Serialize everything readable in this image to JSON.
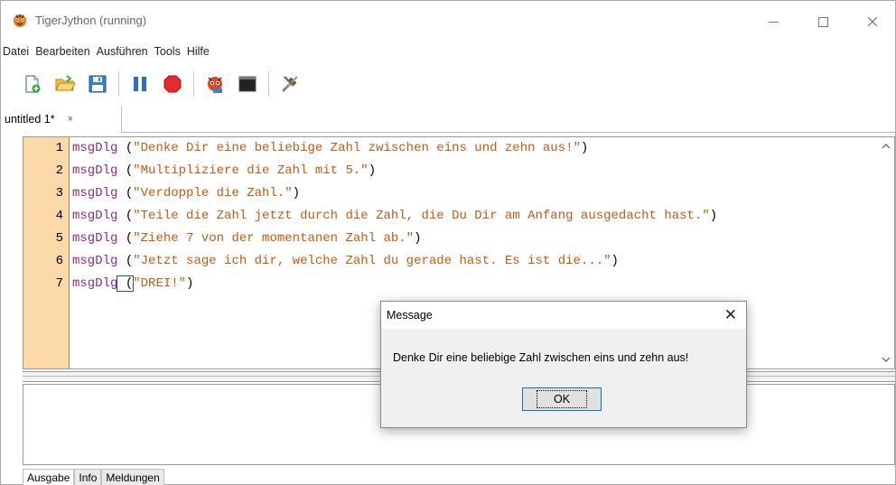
{
  "window": {
    "title": "TigerJython (running)"
  },
  "menu": [
    "Datei",
    "Bearbeiten",
    "Ausführen",
    "Tools",
    "Hilfe"
  ],
  "toolbar": {
    "icons": [
      "new-file-icon",
      "open-folder-icon",
      "save-icon",
      "pause-icon",
      "stop-icon",
      "debugger-icon",
      "console-icon",
      "tools-icon"
    ]
  },
  "tabs": [
    {
      "label": "untitled 1*",
      "close": "×"
    }
  ],
  "editor": {
    "line_numbers": [
      "1",
      "2",
      "3",
      "4",
      "5",
      "6",
      "7"
    ],
    "lines": [
      {
        "fn": "msgDlg",
        "open": " (",
        "str": "\"Denke Dir eine beliebige Zahl zwischen eins und zehn aus!\"",
        "close": ")"
      },
      {
        "fn": "msgDlg",
        "open": " (",
        "str": "\"Multipliziere die Zahl mit 5.\"",
        "close": ")"
      },
      {
        "fn": "msgDlg",
        "open": " (",
        "str": "\"Verdopple die Zahl.\"",
        "close": ")"
      },
      {
        "fn": "msgDlg",
        "open": " (",
        "str": "\"Teile die Zahl jetzt durch die Zahl, die Du Dir am Anfang ausgedacht hast.\"",
        "close": ")"
      },
      {
        "fn": "msgDlg",
        "open": " (",
        "str": "\"Ziehe 7 von der momentanen Zahl ab.\"",
        "close": ")"
      },
      {
        "fn": "msgDlg",
        "open": " (",
        "str": "\"Jetzt sage ich dir, welche Zahl du gerade hast. Es ist die...\"",
        "close": ")"
      },
      {
        "fn": "msgDlg",
        "open": " (",
        "str": "\"DREI!\"",
        "close": ")"
      }
    ]
  },
  "bottom_tabs": [
    "Ausgabe",
    "Info",
    "Meldungen"
  ],
  "dialog": {
    "title": "Message",
    "close": "✕",
    "message": "Denke Dir eine beliebige Zahl zwischen eins und zehn aus!",
    "ok_label": "OK"
  },
  "colors": {
    "gutter": "#fcd9a8",
    "keyword": "#8b2b8b",
    "string": "#c55a11",
    "focus": "#0078d7"
  }
}
